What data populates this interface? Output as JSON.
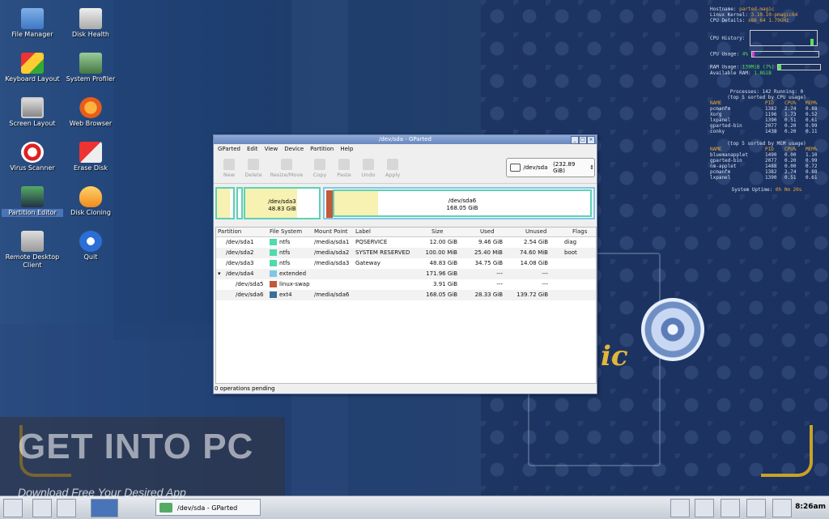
{
  "desktop_icons": [
    {
      "id": "file-manager",
      "label": "File Manager",
      "icon": "folder-icon"
    },
    {
      "id": "disk-health",
      "label": "Disk Health",
      "icon": "disk-icon"
    },
    {
      "id": "keyboard-layout",
      "label": "Keyboard Layout",
      "icon": "keyboard-icon"
    },
    {
      "id": "system-profiler",
      "label": "System Profiler",
      "icon": "profiler-icon"
    },
    {
      "id": "screen-layout",
      "label": "Screen Layout",
      "icon": "monitor-icon"
    },
    {
      "id": "web-browser",
      "label": "Web Browser",
      "icon": "firefox-icon"
    },
    {
      "id": "virus-scanner",
      "label": "Virus Scanner",
      "icon": "scanner-icon"
    },
    {
      "id": "erase-disk",
      "label": "Erase Disk",
      "icon": "eraser-icon"
    },
    {
      "id": "partition-editor",
      "label": "Partition Editor",
      "icon": "partition-icon",
      "selected": true
    },
    {
      "id": "disk-cloning",
      "label": "Disk Cloning",
      "icon": "clone-icon"
    },
    {
      "id": "remote-desktop",
      "label": "Remote Desktop Client",
      "icon": "remote-icon"
    },
    {
      "id": "quit",
      "label": "Quit",
      "icon": "power-icon"
    }
  ],
  "conky": {
    "hostname_label": "Hostname:",
    "hostname": "parted-magic",
    "kernel_label": "Linux Kernel:",
    "kernel": "3.10.10-pmagic64",
    "cpu_details_label": "CPU Details:",
    "cpu_details": "x86_64 1.79GHz",
    "cpu_history_label": "CPU History:",
    "cpu_usage_label": "CPU Usage:",
    "cpu_usage_value": "4%",
    "cpu_usage_pct": 4,
    "ram_usage_label": "RAM Usage:",
    "ram_usage_value": "139MiB (7%)",
    "ram_usage_pct": 7,
    "available_ram_label": "Available RAM:",
    "available_ram": "1.8GiB",
    "processes_line": "Processes: 142 Running: 0",
    "cpu_top_title": "(top 5 sorted by CPU usage)",
    "mem_top_title": "(top 5 sorted by MEM usage)",
    "col_name": "NAME",
    "col_pid": "PID",
    "col_cpu": "CPU%",
    "col_mem": "MEM%",
    "cpu_top": [
      {
        "name": "pcmanfm",
        "pid": "1382",
        "cpu": "2.74",
        "mem": "0.88"
      },
      {
        "name": "Xorg",
        "pid": "1196",
        "cpu": "1.73",
        "mem": "0.52"
      },
      {
        "name": "lxpanel",
        "pid": "1390",
        "cpu": "0.51",
        "mem": "0.61"
      },
      {
        "name": "gparted-bin",
        "pid": "2077",
        "cpu": "0.20",
        "mem": "0.99"
      },
      {
        "name": "conky",
        "pid": "1438",
        "cpu": "0.20",
        "mem": "0.11"
      }
    ],
    "mem_top": [
      {
        "name": "bluemanapplet",
        "pid": "1490",
        "cpu": "0.00",
        "mem": "1.10"
      },
      {
        "name": "gparted-bin",
        "pid": "2077",
        "cpu": "0.20",
        "mem": "0.99"
      },
      {
        "name": "nm-applet",
        "pid": "1488",
        "cpu": "0.00",
        "mem": "0.72"
      },
      {
        "name": "pcmanfm",
        "pid": "1382",
        "cpu": "2.74",
        "mem": "0.88"
      },
      {
        "name": "lxpanel",
        "pid": "1390",
        "cpu": "0.51",
        "mem": "0.61"
      }
    ],
    "uptime_label": "System Uptime:",
    "uptime": "0h 0m 20s"
  },
  "window": {
    "title": "/dev/sda - GParted",
    "menu": [
      "GParted",
      "Edit",
      "View",
      "Device",
      "Partition",
      "Help"
    ],
    "toolbar": [
      "New",
      "Delete",
      "Resize/Move",
      "Copy",
      "Paste",
      "Undo",
      "Apply"
    ],
    "device_selector": "/dev/sda",
    "device_size": "(232.89 GiB)",
    "diskmap": {
      "sda3_name": "/dev/sda3",
      "sda3_size": "48.83 GiB",
      "sda6_name": "/dev/sda6",
      "sda6_size": "168.05 GiB"
    },
    "columns": [
      "Partition",
      "File System",
      "Mount Point",
      "Label",
      "Size",
      "Used",
      "Unused",
      "Flags"
    ],
    "partitions": [
      {
        "partition": "/dev/sda1",
        "fs": "ntfs",
        "color": "#4fdbaa",
        "mount": "/media/sda1",
        "label": "PQSERVICE",
        "size": "12.00 GiB",
        "used": "9.46 GiB",
        "unused": "2.54 GiB",
        "flags": "diag"
      },
      {
        "partition": "/dev/sda2",
        "fs": "ntfs",
        "color": "#4fdbaa",
        "mount": "/media/sda2",
        "label": "SYSTEM RESERVED",
        "size": "100.00 MiB",
        "used": "25.40 MiB",
        "unused": "74.60 MiB",
        "flags": "boot"
      },
      {
        "partition": "/dev/sda3",
        "fs": "ntfs",
        "color": "#4fdbaa",
        "mount": "/media/sda3",
        "label": "Gateway",
        "size": "48.83 GiB",
        "used": "34.75 GiB",
        "unused": "14.08 GiB",
        "flags": ""
      },
      {
        "partition": "/dev/sda4",
        "fs": "extended",
        "color": "#80c6e8",
        "mount": "",
        "label": "",
        "size": "171.96 GiB",
        "used": "---",
        "unused": "---",
        "flags": "",
        "expander": "▾"
      },
      {
        "partition": "/dev/sda5",
        "fs": "linux-swap",
        "color": "#c25a3a",
        "mount": "",
        "label": "",
        "size": "3.91 GiB",
        "used": "---",
        "unused": "---",
        "flags": ""
      },
      {
        "partition": "/dev/sda6",
        "fs": "ext4",
        "color": "#3c6e96",
        "mount": "/media/sda6",
        "label": "",
        "size": "168.05 GiB",
        "used": "28.33 GiB",
        "unused": "139.72 GiB",
        "flags": ""
      }
    ],
    "status": "0 operations pending"
  },
  "watermark": {
    "big": "GET INTO PC",
    "small": "Download Free Your Desired App"
  },
  "taskbar": {
    "task_label": "/dev/sda - GParted",
    "clock": "8:26am"
  }
}
